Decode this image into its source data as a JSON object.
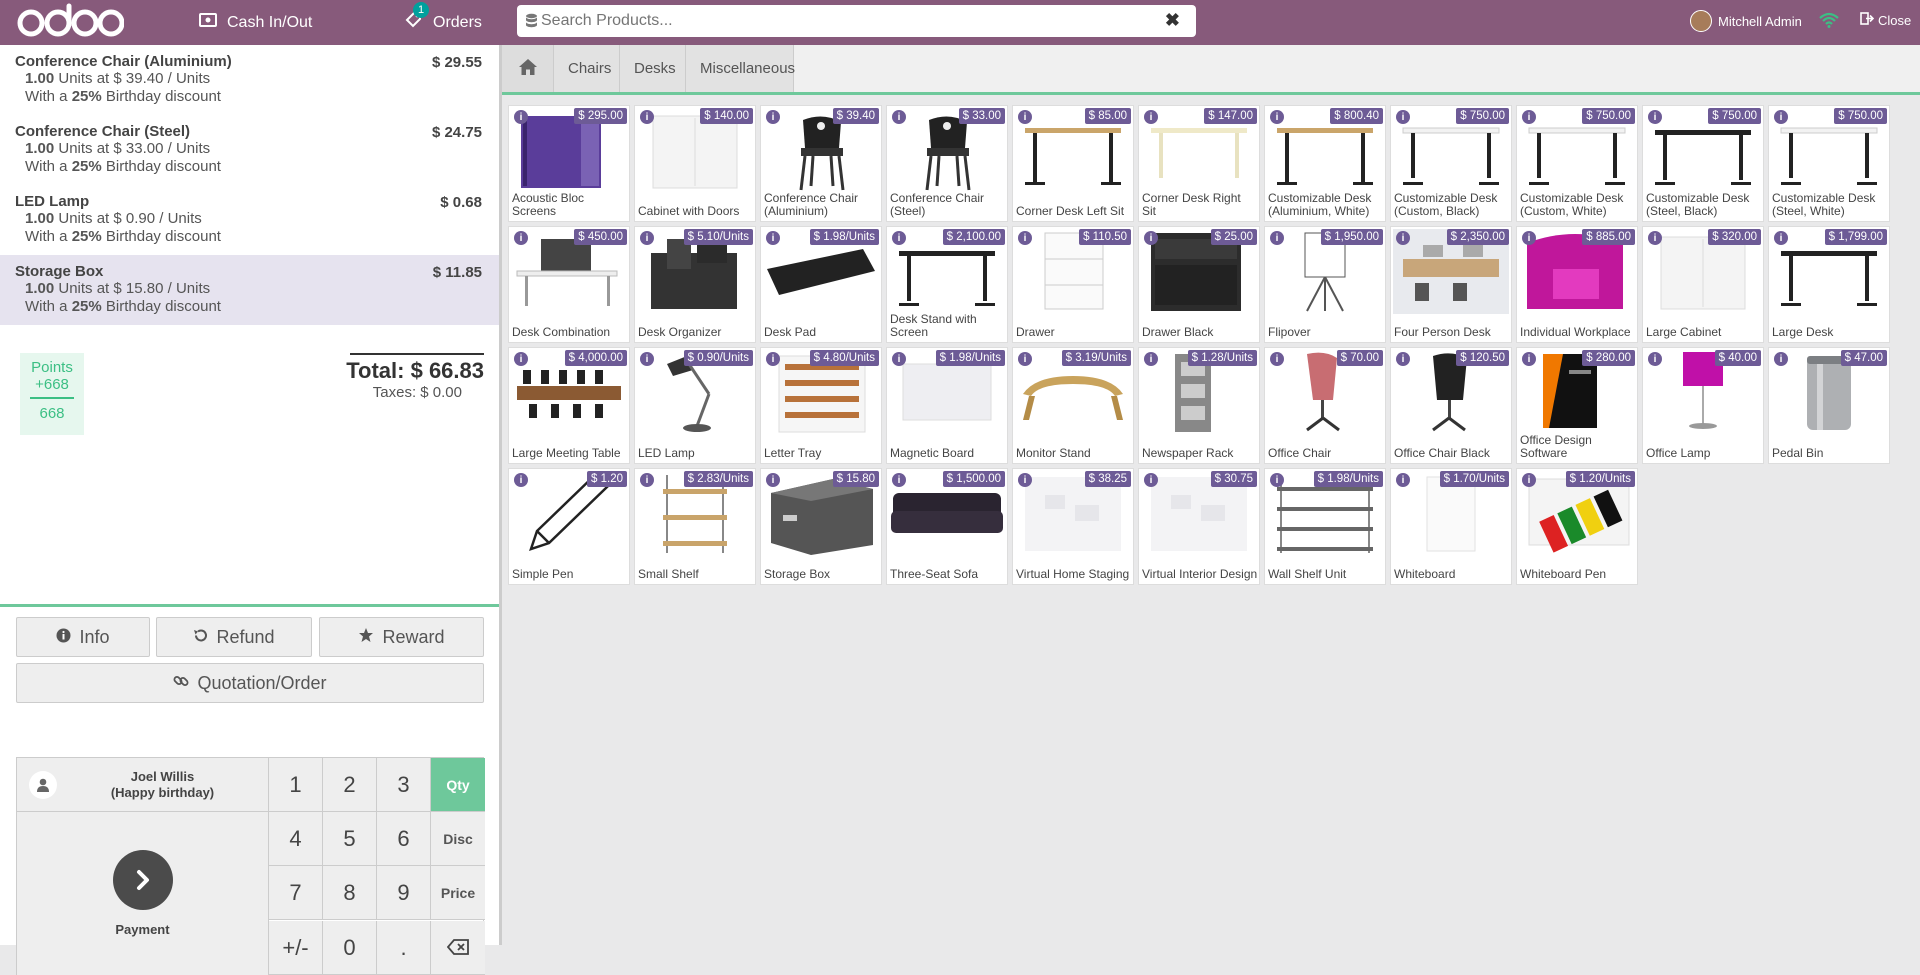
{
  "header": {
    "logo": "odoo",
    "cash_label": "Cash In/Out",
    "orders_label": "Orders",
    "orders_badge": "1",
    "search_placeholder": "Search Products...",
    "user_name": "Mitchell Admin",
    "close_label": "Close"
  },
  "order": {
    "lines": [
      {
        "name": "Conference Chair (Aluminium)",
        "price": "$ 29.55",
        "qty": "1.00",
        "unit_text": "Units at $ 39.40 / Units",
        "discount_pre": "With a ",
        "discount_pct": "25%",
        "discount_post": " Birthday discount",
        "selected": false
      },
      {
        "name": "Conference Chair (Steel)",
        "price": "$ 24.75",
        "qty": "1.00",
        "unit_text": "Units at $ 33.00 / Units",
        "discount_pre": "With a ",
        "discount_pct": "25%",
        "discount_post": " Birthday discount",
        "selected": false
      },
      {
        "name": "LED Lamp",
        "price": "$ 0.68",
        "qty": "1.00",
        "unit_text": "Units at $ 0.90 / Units",
        "discount_pre": "With a ",
        "discount_pct": "25%",
        "discount_post": " Birthday discount",
        "selected": false
      },
      {
        "name": "Storage Box",
        "price": "$ 11.85",
        "qty": "1.00",
        "unit_text": "Units at $ 15.80 / Units",
        "discount_pre": "With a ",
        "discount_pct": "25%",
        "discount_post": " Birthday discount",
        "selected": true
      }
    ],
    "points_label": "Points",
    "points_won": "+668",
    "points_total": "668",
    "total": "Total: $ 66.83",
    "taxes": "Taxes: $ 0.00"
  },
  "controls": {
    "info": "Info",
    "refund": "Refund",
    "reward": "Reward",
    "quotation": "Quotation/Order"
  },
  "customer": {
    "name": "Joel Willis",
    "note": "(Happy birthday)"
  },
  "payment_label": "Payment",
  "numpad": {
    "keys": [
      "1",
      "2",
      "3",
      "4",
      "5",
      "6",
      "7",
      "8",
      "9",
      "+/-",
      "0",
      "."
    ],
    "modes": [
      "Qty",
      "Disc",
      "Price"
    ],
    "active_mode": "Qty"
  },
  "categories": [
    "Chairs",
    "Desks",
    "Miscellaneous"
  ],
  "products": [
    {
      "name": "Acoustic Bloc Screens",
      "price": "$ 295.00",
      "icon": "screen"
    },
    {
      "name": "Cabinet with Doors",
      "price": "$ 140.00",
      "icon": "cabinet"
    },
    {
      "name": "Conference Chair (Aluminium)",
      "price": "$ 39.40",
      "icon": "chair"
    },
    {
      "name": "Conference Chair (Steel)",
      "price": "$ 33.00",
      "icon": "chair"
    },
    {
      "name": "Corner Desk Left Sit",
      "price": "$ 85.00",
      "icon": "desk-wood"
    },
    {
      "name": "Corner Desk Right Sit",
      "price": "$ 147.00",
      "icon": "desk-light"
    },
    {
      "name": "Customizable Desk (Aluminium, White)",
      "price": "$ 800.40",
      "icon": "desk-wood"
    },
    {
      "name": "Customizable Desk (Custom, Black)",
      "price": "$ 750.00",
      "icon": "desk-white"
    },
    {
      "name": "Customizable Desk (Custom, White)",
      "price": "$ 750.00",
      "icon": "desk-white"
    },
    {
      "name": "Customizable Desk (Steel, Black)",
      "price": "$ 750.00",
      "icon": "desk-black"
    },
    {
      "name": "Customizable Desk (Steel, White)",
      "price": "$ 750.00",
      "icon": "desk-white"
    },
    {
      "name": "Desk Combination",
      "price": "$ 450.00",
      "icon": "desk-combo"
    },
    {
      "name": "Desk Organizer",
      "price": "$ 5.10/Units",
      "icon": "organizer"
    },
    {
      "name": "Desk Pad",
      "price": "$ 1.98/Units",
      "icon": "pad"
    },
    {
      "name": "Desk Stand with Screen",
      "price": "$ 2,100.00",
      "icon": "desk-black"
    },
    {
      "name": "Drawer",
      "price": "$ 110.50",
      "icon": "drawer"
    },
    {
      "name": "Drawer Black",
      "price": "$ 25.00",
      "icon": "drawer-black"
    },
    {
      "name": "Flipover",
      "price": "$ 1,950.00",
      "icon": "flipover"
    },
    {
      "name": "Four Person Desk",
      "price": "$ 2,350.00",
      "icon": "office"
    },
    {
      "name": "Individual Workplace",
      "price": "$ 885.00",
      "icon": "pink"
    },
    {
      "name": "Large Cabinet",
      "price": "$ 320.00",
      "icon": "cabinet"
    },
    {
      "name": "Large Desk",
      "price": "$ 1,799.00",
      "icon": "desk-black"
    },
    {
      "name": "Large Meeting Table",
      "price": "$ 4,000.00",
      "icon": "meeting"
    },
    {
      "name": "LED Lamp",
      "price": "$ 0.90/Units",
      "icon": "lamp"
    },
    {
      "name": "Letter Tray",
      "price": "$ 4.80/Units",
      "icon": "tray"
    },
    {
      "name": "Magnetic Board",
      "price": "$ 1.98/Units",
      "icon": "board"
    },
    {
      "name": "Monitor Stand",
      "price": "$ 3.19/Units",
      "icon": "stand"
    },
    {
      "name": "Newspaper Rack",
      "price": "$ 1.28/Units",
      "icon": "rack"
    },
    {
      "name": "Office Chair",
      "price": "$ 70.00",
      "icon": "chair-pink"
    },
    {
      "name": "Office Chair Black",
      "price": "$ 120.50",
      "icon": "chair-black"
    },
    {
      "name": "Office Design Software",
      "price": "$ 280.00",
      "icon": "software"
    },
    {
      "name": "Office Lamp",
      "price": "$ 40.00",
      "icon": "lamp-pink"
    },
    {
      "name": "Pedal Bin",
      "price": "$ 47.00",
      "icon": "bin"
    },
    {
      "name": "Simple Pen",
      "price": "$ 1.20",
      "icon": "pen"
    },
    {
      "name": "Small Shelf",
      "price": "$ 2.83/Units",
      "icon": "shelf"
    },
    {
      "name": "Storage Box",
      "price": "$ 15.80",
      "icon": "box"
    },
    {
      "name": "Three-Seat Sofa",
      "price": "$ 1,500.00",
      "icon": "sofa"
    },
    {
      "name": "Virtual Home Staging",
      "price": "$ 38.25",
      "icon": "faded"
    },
    {
      "name": "Virtual Interior Design",
      "price": "$ 30.75",
      "icon": "faded"
    },
    {
      "name": "Wall Shelf Unit",
      "price": "$ 1.98/Units",
      "icon": "wallshelf"
    },
    {
      "name": "Whiteboard",
      "price": "$ 1.70/Units",
      "icon": "whiteboard"
    },
    {
      "name": "Whiteboard Pen",
      "price": "$ 1.20/Units",
      "icon": "markers"
    }
  ],
  "colors": {
    "brand": "#875a7b",
    "accent": "#6ec89b",
    "price_tag": "#6d5b96"
  }
}
